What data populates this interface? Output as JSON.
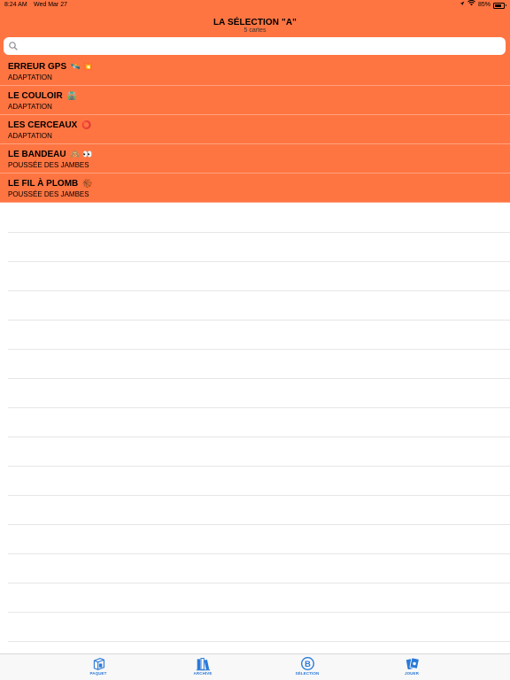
{
  "status_bar": {
    "time": "8:24 AM",
    "date": "Wed Mar 27",
    "battery": "85%"
  },
  "nav": {
    "title": "LA SÉLECTION \"A\"",
    "subtitle": "5 cartes"
  },
  "search": {
    "placeholder": ""
  },
  "cards": [
    {
      "title": "ERREUR GPS",
      "emoji": "🛰️ 💥",
      "subtitle": "ADAPTATION"
    },
    {
      "title": "LE COULOIR",
      "emoji": "🛣️",
      "subtitle": "ADAPTATION"
    },
    {
      "title": "LES CERCEAUX",
      "emoji": "⭕",
      "subtitle": "ADAPTATION"
    },
    {
      "title": "LE BANDEAU",
      "emoji": "🙈 👀",
      "subtitle": "POUSSÉE DES JAMBES"
    },
    {
      "title": "LE FIL À PLOMB",
      "emoji": "🏀",
      "subtitle": "POUSSÉE DES JAMBES"
    }
  ],
  "tabs": [
    {
      "label": "PAQUET",
      "icon": "deck-icon"
    },
    {
      "label": "ARCHIVE",
      "icon": "archive-icon"
    },
    {
      "label": "SÉLECTION",
      "icon": "selection-b-icon"
    },
    {
      "label": "JOUER",
      "icon": "play-cards-icon"
    }
  ],
  "colors": {
    "accent": "#ff7542",
    "tab_tint": "#2a7ad8"
  }
}
